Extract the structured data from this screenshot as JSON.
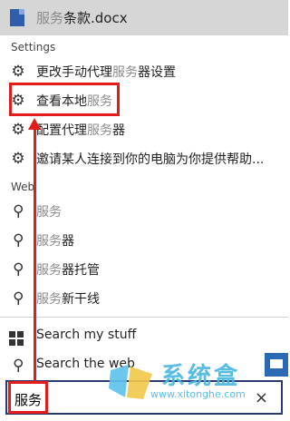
{
  "top_result": {
    "name_highlight": "服务",
    "name_rest": "条款.docx"
  },
  "sections": {
    "settings": "Settings",
    "web": "Web"
  },
  "settings_items": [
    {
      "pre": "更改手动代理",
      "hl": "服务",
      "post": "器设置"
    },
    {
      "pre": "查看本地",
      "hl": "服务",
      "post": ""
    },
    {
      "pre": "配置代理",
      "hl": "服务",
      "post": "器"
    },
    {
      "pre": "邀请某人连接到你的电脑为你提供帮助...",
      "hl": "",
      "post": ""
    }
  ],
  "web_items": [
    {
      "hl": "服务",
      "post": ""
    },
    {
      "hl": "服务",
      "post": "器"
    },
    {
      "hl": "服务",
      "post": "器托管"
    },
    {
      "hl": "服务",
      "post": "新干线"
    }
  ],
  "bottom": {
    "my_stuff": "Search my stuff",
    "web": "Search the web"
  },
  "search": {
    "value": "服务",
    "clear": "×"
  },
  "watermark": {
    "cn": "系统盒",
    "url": "www.xitonghe.com"
  },
  "icons": {
    "gear": "gear-icon",
    "search": "search-icon",
    "windows": "windows-icon",
    "document": "word-document-icon"
  },
  "colors": {
    "annotation": "#e21b1b",
    "searchbox_border": "#2a3a72",
    "watermark": "#47b6e3"
  }
}
